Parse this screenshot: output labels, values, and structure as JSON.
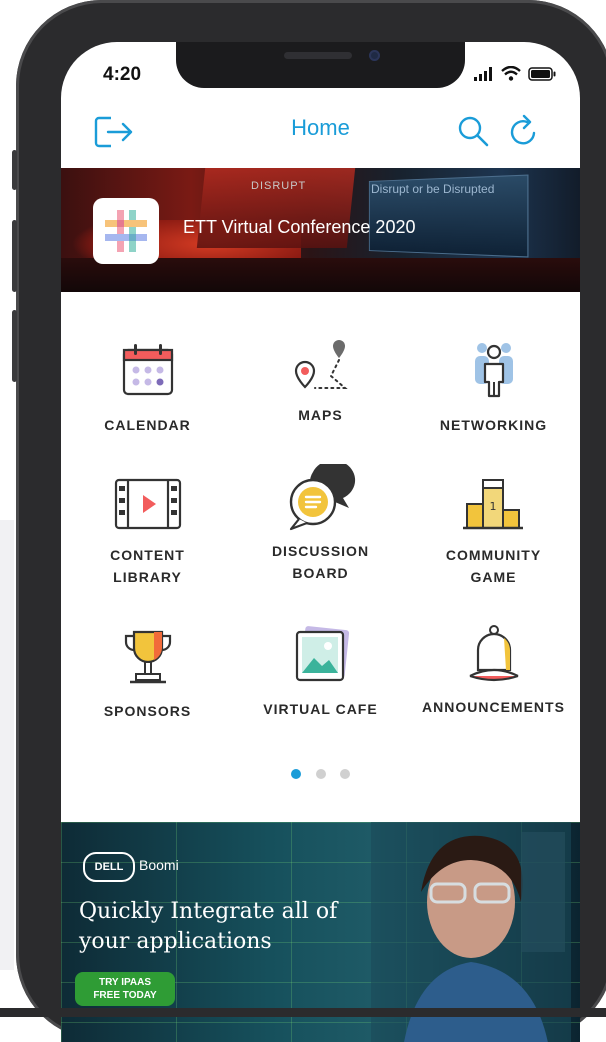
{
  "status_bar": {
    "time": "4:20"
  },
  "navbar": {
    "title": "Home",
    "left_icon": "logout-icon",
    "right_icons": [
      "search-icon",
      "refresh-icon"
    ],
    "accent_color": "#1a9cd8"
  },
  "banner": {
    "title": "ETT Virtual Conference 2020",
    "background_text_1": "Disrupt or be Disrupted",
    "background_text_2": "DISRUPT"
  },
  "menu": {
    "items": [
      {
        "label": "CALENDAR",
        "icon": "calendar-icon"
      },
      {
        "label": "MAPS",
        "icon": "map-pin-icon"
      },
      {
        "label": "NETWORKING",
        "icon": "people-icon"
      },
      {
        "label": "CONTENT\nLIBRARY",
        "icon": "video-film-icon"
      },
      {
        "label": "DISCUSSION\nBOARD",
        "icon": "chat-bubble-icon"
      },
      {
        "label": "COMMUNITY\nGAME",
        "icon": "podium-icon"
      },
      {
        "label": "SPONSORS",
        "icon": "trophy-icon"
      },
      {
        "label": "VIRTUAL CAFE",
        "icon": "picture-icon"
      },
      {
        "label": "ANNOUNCEMENTS",
        "icon": "bell-icon"
      }
    ]
  },
  "pager": {
    "count": 3,
    "active": 0
  },
  "ad": {
    "brand_1": "DELL",
    "brand_2": "Boomi",
    "headline_line1": "Quickly Integrate all of",
    "headline_line2": "your applications",
    "cta_line1": "TRY IPAAS",
    "cta_line2": "FREE TODAY"
  }
}
